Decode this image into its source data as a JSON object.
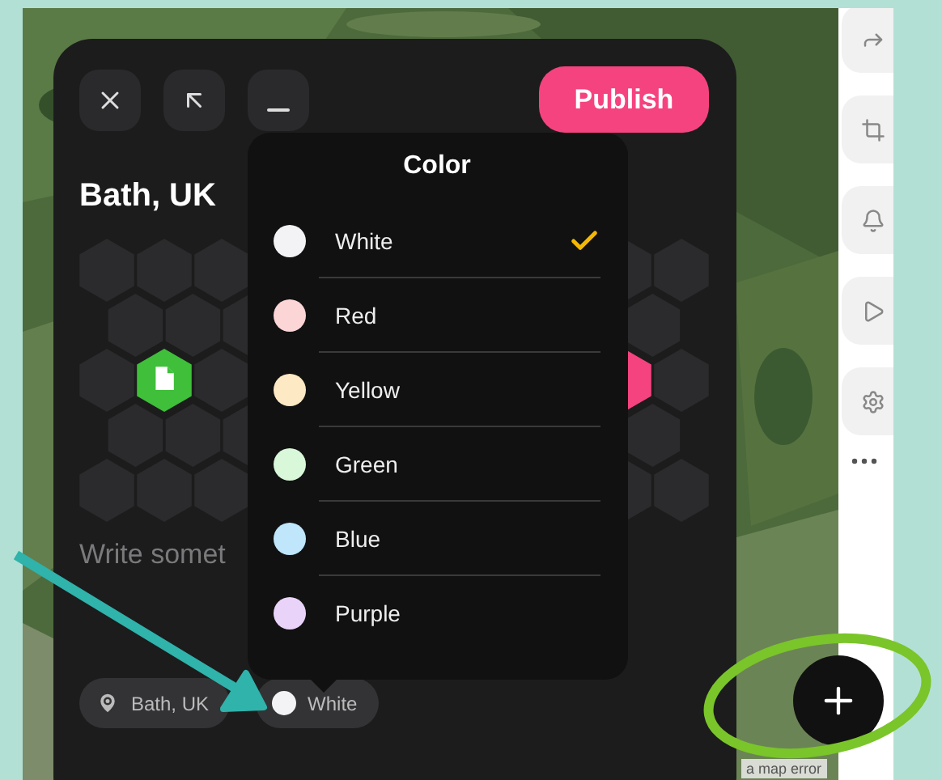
{
  "publish_button": "Publish",
  "title": "Bath, UK",
  "note": {
    "placeholder": "Write somet"
  },
  "chips": [
    {
      "kind": "location",
      "label": "Bath, UK"
    },
    {
      "kind": "color",
      "label": "White",
      "color": "#f3f3f5"
    }
  ],
  "color_menu": {
    "title": "Color",
    "options": [
      {
        "label": "White",
        "color": "#f3f3f5",
        "selected": true
      },
      {
        "label": "Red",
        "color": "#fcd5d6",
        "selected": false
      },
      {
        "label": "Yellow",
        "color": "#fde9c4",
        "selected": false
      },
      {
        "label": "Green",
        "color": "#d9f7d9",
        "selected": false
      },
      {
        "label": "Blue",
        "color": "#bfe6fb",
        "selected": false
      },
      {
        "label": "Purple",
        "color": "#ead3f8",
        "selected": false
      }
    ]
  },
  "map_attribution": "a map error"
}
